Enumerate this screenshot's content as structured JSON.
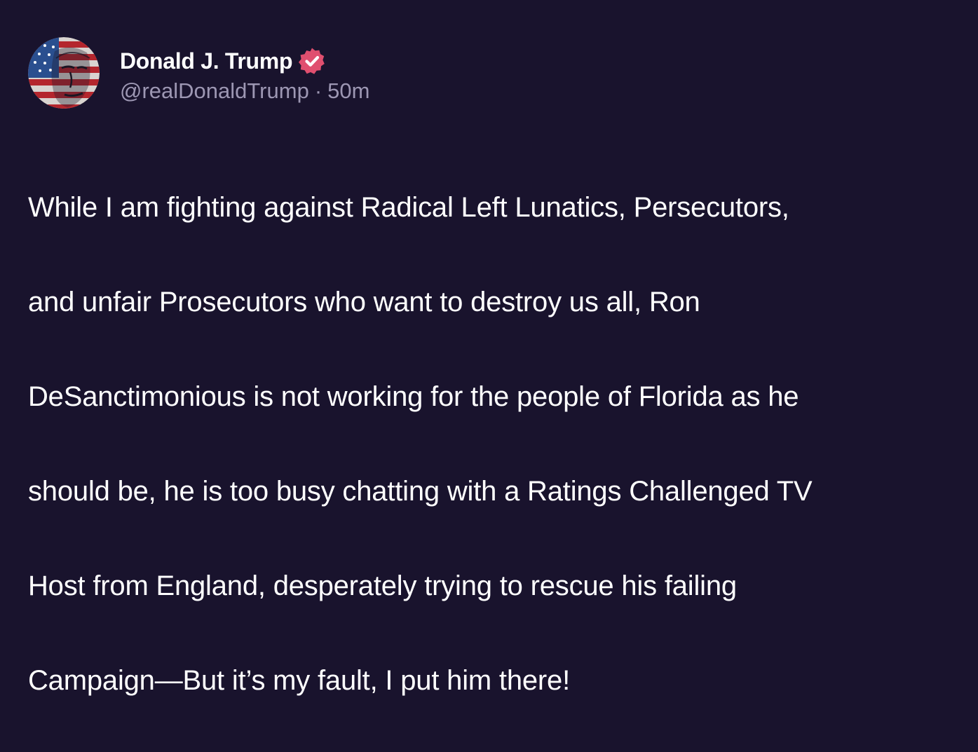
{
  "post": {
    "author": {
      "display_name": "Donald J. Trump",
      "handle": "@realDonaldTrump",
      "verified": true,
      "avatar_icon": "flag-portrait-avatar"
    },
    "separator": "·",
    "timestamp": "50m",
    "body_lines": [
      "While I am fighting against Radical Left Lunatics, Persecutors,",
      "and unfair Prosecutors who want to destroy us all, Ron",
      "DeSanctimonious is not working for the people of Florida as he",
      "should be, he is too busy chatting with a Ratings Challenged TV",
      "Host from England, desperately trying to rescue his failing",
      "Campaign—But it’s my fault, I put him there!"
    ]
  },
  "colors": {
    "background": "#19132d",
    "text": "#ffffff",
    "meta_text": "#9d97b3",
    "verified_badge": "#e04f6f"
  }
}
